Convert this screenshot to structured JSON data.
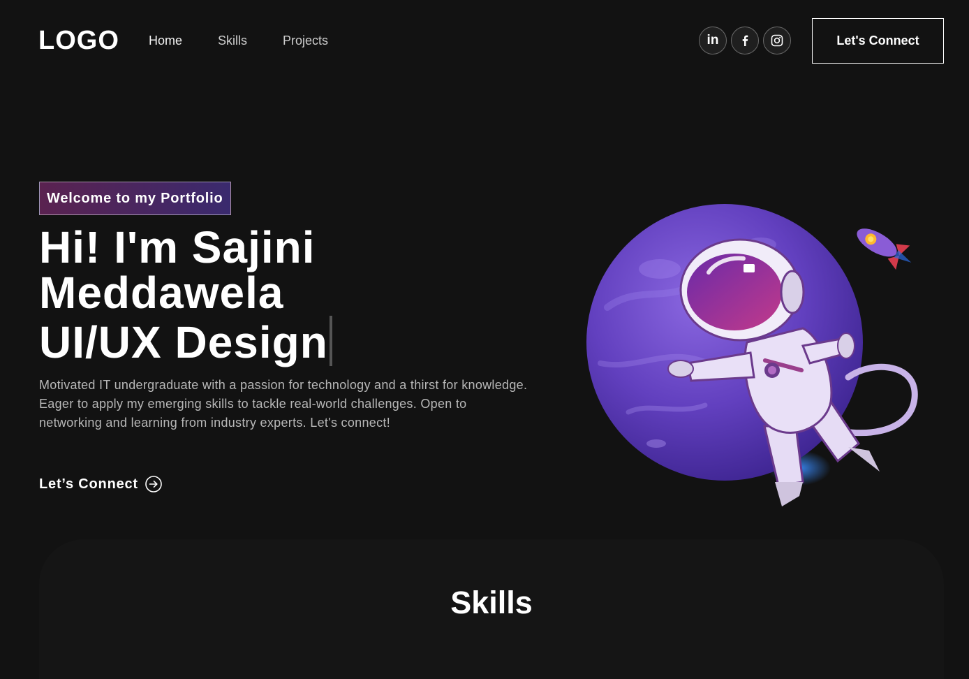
{
  "nav": {
    "logo": "LOGO",
    "links": [
      {
        "label": "Home"
      },
      {
        "label": "Skills"
      },
      {
        "label": "Projects"
      }
    ],
    "socials": [
      {
        "icon": "linkedin-icon",
        "label": "in"
      },
      {
        "icon": "facebook-icon"
      },
      {
        "icon": "instagram-icon"
      }
    ],
    "connect_button": "Let's Connect"
  },
  "hero": {
    "tagline": "Welcome to my Portfolio",
    "headline_line1": "Hi! I'm Sajini",
    "headline_line2": "Meddawela",
    "headline_line3": "UI/UX Design",
    "description": "Motivated IT undergraduate with a passion for technology and a thirst for knowledge. Eager to apply my emerging skills to tackle real-world challenges. Open to networking and learning from industry experts. Let's connect!",
    "cta_label": "Let’s Connect",
    "cta_icon": "arrow-right-circle-icon",
    "illustration": "astronaut-planet-illustration"
  },
  "skills": {
    "title": "Skills"
  },
  "colors": {
    "background": "#121212",
    "tagline_gradient_start": "#5a2250",
    "tagline_gradient_end": "#3a2a6e",
    "planet": "#6b3fc4",
    "accent_purple": "#9a3f8c"
  }
}
